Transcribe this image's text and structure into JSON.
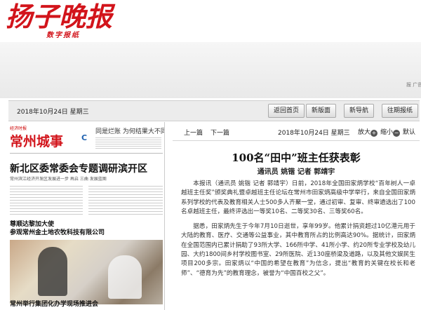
{
  "masthead": {
    "logo": "扬子晚报",
    "subtitle": "数字报纸",
    "edge_text": "报 广告"
  },
  "toolbar": {
    "date": "2018年10月24日 星期三",
    "buttons": [
      "返回首页",
      "新版面",
      "新导航",
      "往期报纸"
    ]
  },
  "preview": {
    "tag": "经济时报",
    "section_title": "常州城事",
    "section_letter": "C",
    "side_headline": "同是烂账 为何结果大不同",
    "headline1": "新北区委常委会专题调研滨开区",
    "small_line": "常州滨江经济开发区发展进一步 再启 三曲 发展蓝图",
    "headline2": "尊顺达黎加大使",
    "headline3": "参观常州金土地农牧科技有限公司",
    "headline4": "常州举行集团化办学现场推进会"
  },
  "article_nav": {
    "prev": "上一篇",
    "next": "下一篇",
    "date": "2018年10月24日 星期三",
    "zoom_in": "放大",
    "zoom_out": "缩小",
    "default": "默认"
  },
  "article": {
    "title": "100名“田中”班主任获表彰",
    "byline": "通讯员 姚锴 记者 郭靖宇",
    "paragraphs": [
      "本报讯（通讯员 姚锴 记者 郭靖宇）日前，2018年全国田家炳学校“百年树人一卓越班主任奖”颁奖典礼暨卓越班主任论坛在常州市田家炳高级中学举行，来自全国田家炳系列学校的代表及教育相关人士500多人齐聚一堂，通过初审、复审、终审遴选出了100名卓越班主任，最终评选出一等奖10名、二等奖30名、三等奖60名。",
      "据悉，田家炳先生于今年7月10日逝世，享年99岁。他累计捐资超过10亿港元用于大陆的教育、医疗、交通等公益事业，其中教育所占的比例高达90%。据统计，田家炳在全国范围内已累计捐助了93所大学、166所中学、41所小学、约20所专业学校及幼儿园、大约1800间乡村学校图书室、29所医院、近130座桥梁及道路，以及其他文娱民生项目200多宗。田家炳以“中国的希望在教育”为信念，提出“教育的关键在校长和老师”、“德育为先”的教育理念，被誉为“中国百校之父”。"
    ]
  },
  "colors": {
    "brand_red": "#d2141b",
    "accent_blue": "#1f62b0"
  }
}
